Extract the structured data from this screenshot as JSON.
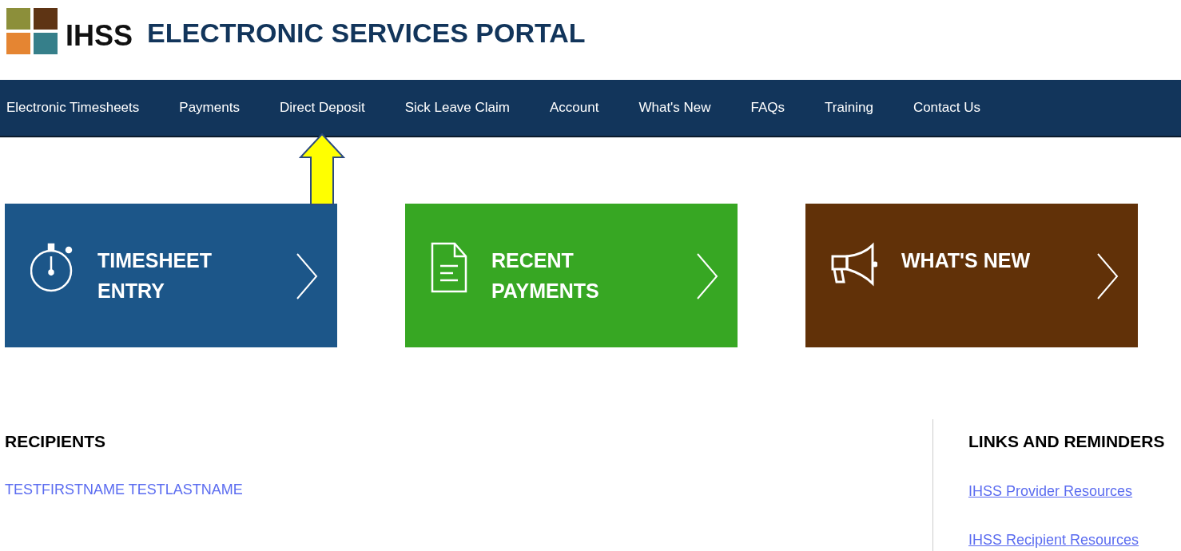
{
  "header": {
    "logo_text": "IHSS",
    "title": "ELECTRONIC SERVICES PORTAL"
  },
  "nav": [
    {
      "label": "Electronic Timesheets",
      "highlighted": false
    },
    {
      "label": "Payments",
      "highlighted": false
    },
    {
      "label": "Direct Deposit",
      "highlighted": true
    },
    {
      "label": "Sick Leave Claim",
      "highlighted": false
    },
    {
      "label": "Account",
      "highlighted": false
    },
    {
      "label": "What's New",
      "highlighted": false
    },
    {
      "label": "FAQs",
      "highlighted": false
    },
    {
      "label": "Training",
      "highlighted": false
    },
    {
      "label": "Contact Us",
      "highlighted": false
    }
  ],
  "tiles": [
    {
      "kind": "stopwatch",
      "color": "#1c5689",
      "lines": [
        "TIMESHEET",
        "ENTRY"
      ]
    },
    {
      "kind": "document",
      "color": "#37a723",
      "lines": [
        "RECENT",
        "PAYMENTS"
      ]
    },
    {
      "kind": "megaphone",
      "color": "#613108",
      "lines": [
        "WHAT'S NEW"
      ]
    }
  ],
  "recipients": {
    "heading": "RECIPIENTS",
    "names": [
      "TESTFIRSTNAME TESTLASTNAME"
    ]
  },
  "links": {
    "heading": "LINKS AND REMINDERS",
    "items": [
      "IHSS Provider Resources",
      "IHSS Recipient Resources"
    ]
  }
}
